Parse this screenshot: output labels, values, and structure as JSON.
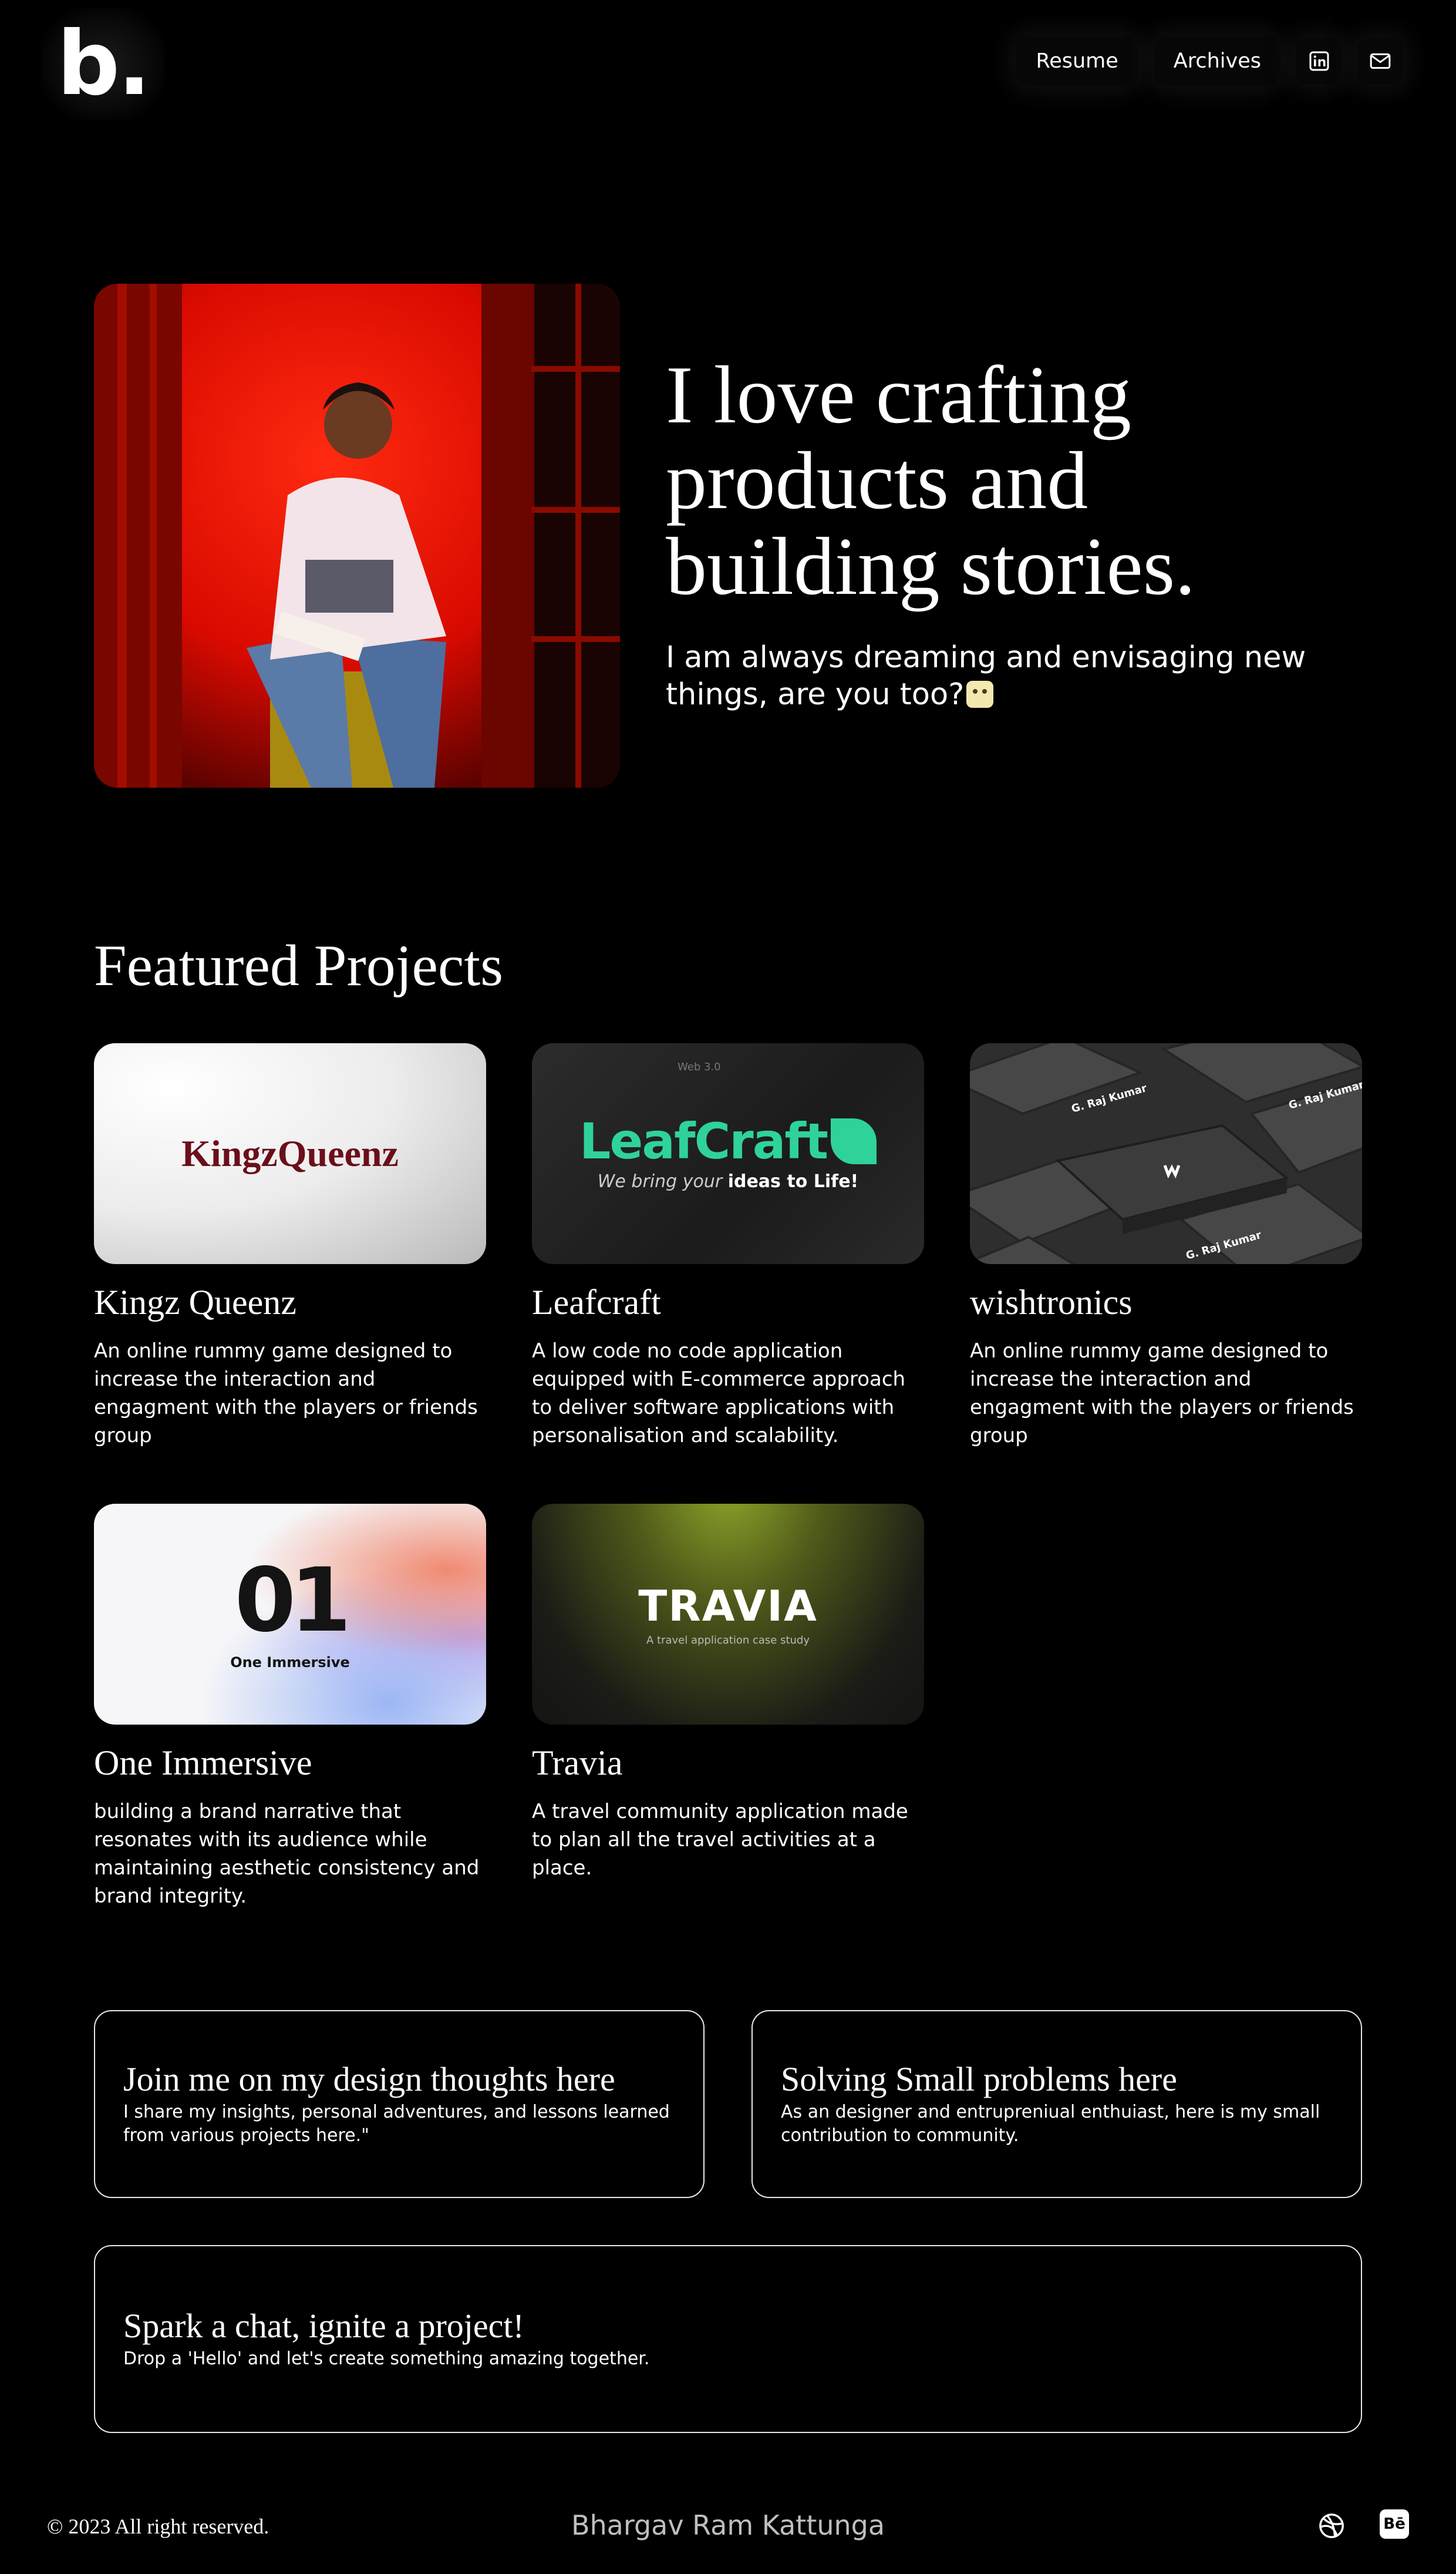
{
  "header": {
    "logo": "b.",
    "nav": [
      {
        "label": "Resume"
      },
      {
        "label": "Archives"
      }
    ],
    "icons": [
      "linkedin-icon",
      "mail-icon"
    ]
  },
  "hero": {
    "title": "I love crafting products and building stories.",
    "subtitle": "I am always dreaming and envisaging new things, are you too?"
  },
  "projects": {
    "heading": "Featured Projects",
    "items": [
      {
        "title": "Kingz Queenz",
        "desc": "An online rummy game designed to increase the interaction and engagment with the players or friends group",
        "thumb_text": "KingzQueenz"
      },
      {
        "title": "Leafcraft",
        "desc": "A low code no code application equipped with E-commerce approach to deliver software applications with personalisation and scalability.",
        "thumb_text": "LeafCraft",
        "thumb_tagline_1": "We bring your ",
        "thumb_tagline_2": "ideas to Life!",
        "thumb_badge": "Web 3.0"
      },
      {
        "title": "wishtronics",
        "desc": "An online rummy game designed to increase the interaction and engagment with the players or friends group",
        "thumb_name": "G. Raj Kumar"
      },
      {
        "title": "One Immersive",
        "desc": "building a brand narrative that resonates with its audience while maintaining aesthetic consistency and brand integrity.",
        "thumb_text": "One Immersive",
        "thumb_mark": "01"
      },
      {
        "title": "Travia",
        "desc": "A travel community application made to plan all the travel activities at a place.",
        "thumb_text": "TRAVIA",
        "thumb_tagline": "A travel application case study"
      }
    ]
  },
  "links": {
    "design": {
      "title": "Join me on my design thoughts here",
      "desc": "I share my insights, personal adventures, and lessons learned from various projects here.\""
    },
    "problems": {
      "title": "Solving Small problems here",
      "desc": "As an designer and entrupreniual enthuiast, here is my small contribution to community."
    },
    "contact": {
      "title": "Spark a chat, ignite a project!",
      "desc": "Drop a 'Hello' and let's create something amazing together."
    }
  },
  "footer": {
    "copyright": "© 2023 All right reserved.",
    "name": "Bhargav Ram Kattunga",
    "icons": [
      "dribbble-icon",
      "behance-icon"
    ],
    "behance_text": "Bē"
  },
  "colors": {
    "background": "#000000",
    "leafcraft_green": "#2fd39a",
    "kingz_maroon": "#6b0f1a",
    "travia_green": "#8fa52a"
  }
}
